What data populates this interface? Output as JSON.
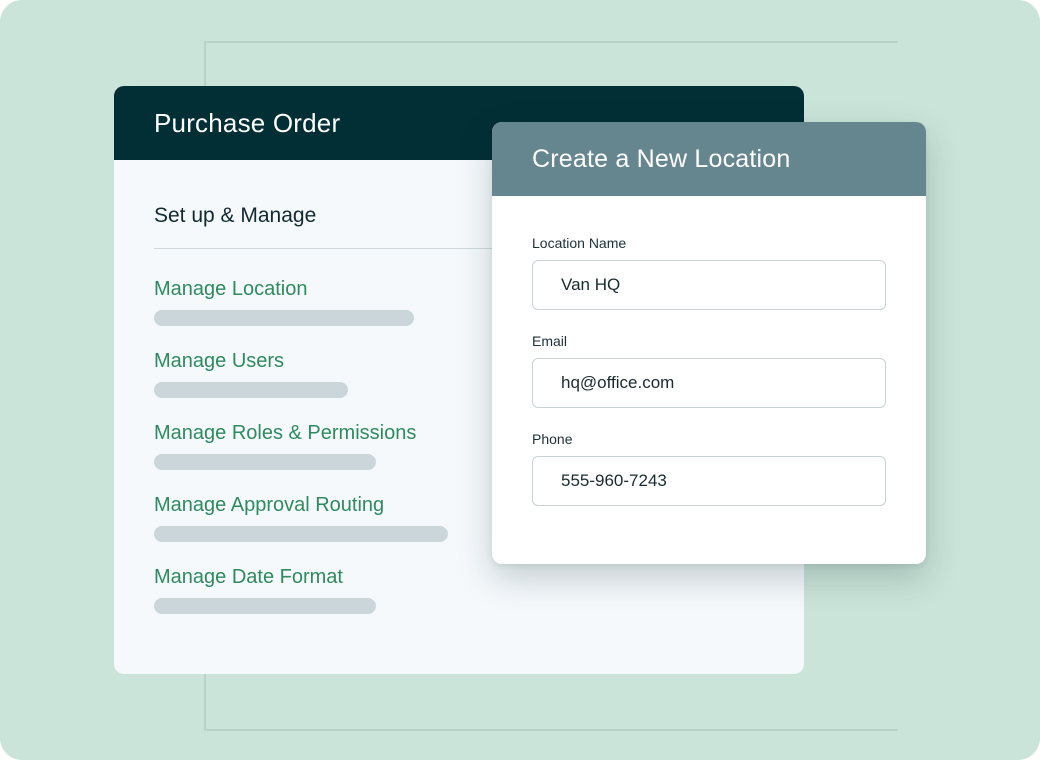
{
  "purchase_order": {
    "title": "Purchase Order",
    "section_title": "Set up & Manage",
    "menu": [
      {
        "label": "Manage Location",
        "bar_width_fraction": 0.65
      },
      {
        "label": "Manage Users",
        "bar_width_fraction": 0.485
      },
      {
        "label": "Manage Roles & Permissions",
        "bar_width_fraction": 0.555
      },
      {
        "label": "Manage Approval Routing",
        "bar_width_fraction": 0.735
      },
      {
        "label": "Manage Date Format",
        "bar_width_fraction": 0.555
      }
    ]
  },
  "create_location": {
    "title": "Create a New Location",
    "fields": {
      "location_name": {
        "label": "Location Name",
        "value": "Van HQ"
      },
      "email": {
        "label": "Email",
        "value": "hq@office.com"
      },
      "phone": {
        "label": "Phone",
        "value": "555-960-7243"
      }
    }
  },
  "colors": {
    "background": "#cbe4da",
    "header_dark": "#022e35",
    "modal_header": "#66868f",
    "link_green": "#2f8a5e"
  }
}
